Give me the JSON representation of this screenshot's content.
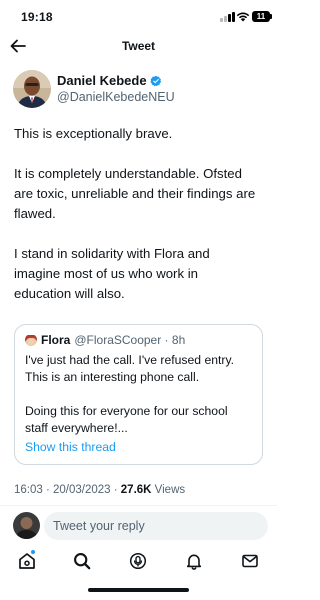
{
  "status_bar": {
    "time": "19:18",
    "battery": "11"
  },
  "header": {
    "title": "Tweet"
  },
  "author": {
    "name": "Daniel Kebede",
    "handle": "@DanielKebedeNEU"
  },
  "tweet": {
    "p1": "This is exceptionally brave.",
    "p2_l1": "It is completely understandable. Ofsted",
    "p2_l2": "are toxic, unreliable and their findings are",
    "p2_l3": "flawed.",
    "p3_l1": "I stand in solidarity with Flora and",
    "p3_l2": "imagine most of us who work in",
    "p3_l3": "education will also."
  },
  "quote": {
    "name": "Flora",
    "handle_time": "@FloraSCooper · 8h",
    "l1": "I've just had the call.  I've refused entry.",
    "l2": "This is an interesting phone call.",
    "l3": "Doing this for everyone for our school",
    "l4": "staff everywhere!...",
    "show_thread": "Show this thread"
  },
  "meta": {
    "timestamp": "16:03 · 20/03/2023 · ",
    "views_count": "27.6K",
    "views_label": " Views"
  },
  "reply": {
    "placeholder": "Tweet your reply"
  },
  "colors": {
    "accent": "#1d9bf0",
    "text": "#0f1419",
    "muted": "#536471",
    "border": "#cfd9de"
  }
}
